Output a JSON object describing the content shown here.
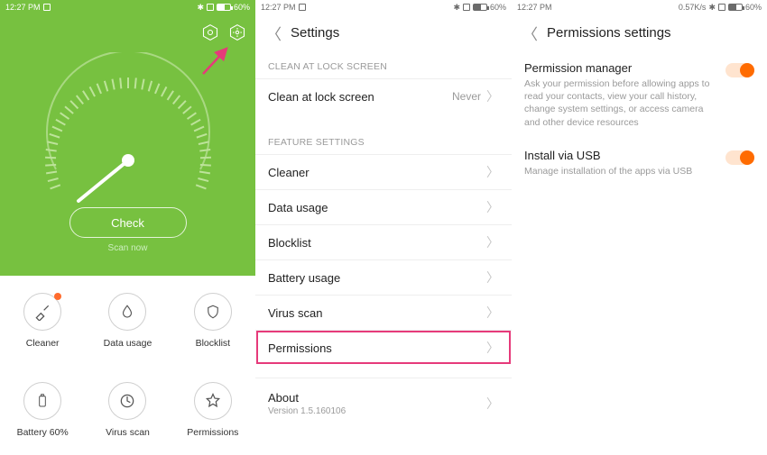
{
  "status": {
    "time": "12:27 PM",
    "battery_pct": "60%",
    "netspeed": "0.57K/s"
  },
  "panel1": {
    "top_icons": [
      "shield-outline-icon",
      "gear-icon"
    ],
    "check_label": "Check",
    "scan_now": "Scan now",
    "tiles": [
      {
        "id": "cleaner",
        "label": "Cleaner",
        "icon": "brush-icon",
        "badge": true
      },
      {
        "id": "data-usage",
        "label": "Data usage",
        "icon": "drop-icon",
        "badge": false
      },
      {
        "id": "blocklist",
        "label": "Blocklist",
        "icon": "shield-icon",
        "badge": false
      },
      {
        "id": "battery",
        "label": "Battery 60%",
        "icon": "battery-icon",
        "badge": false
      },
      {
        "id": "virus-scan",
        "label": "Virus scan",
        "icon": "scan-icon",
        "badge": false
      },
      {
        "id": "permissions",
        "label": "Permissions",
        "icon": "star-icon",
        "badge": false
      }
    ]
  },
  "panel2": {
    "title": "Settings",
    "sections": [
      {
        "title": "CLEAN AT LOCK SCREEN",
        "rows": [
          {
            "id": "clean-lock",
            "label": "Clean at lock screen",
            "value": "Never"
          }
        ]
      },
      {
        "title": "FEATURE SETTINGS",
        "rows": [
          {
            "id": "cleaner",
            "label": "Cleaner"
          },
          {
            "id": "data-usage",
            "label": "Data usage"
          },
          {
            "id": "blocklist",
            "label": "Blocklist"
          },
          {
            "id": "battery-usage",
            "label": "Battery usage"
          },
          {
            "id": "virus-scan",
            "label": "Virus scan"
          },
          {
            "id": "permissions",
            "label": "Permissions",
            "highlight": true
          }
        ]
      }
    ],
    "bottom": {
      "label": "About",
      "sub": "Version 1.5.160106"
    }
  },
  "panel3": {
    "title": "Permissions settings",
    "items": [
      {
        "id": "perm-mgr",
        "title": "Permission manager",
        "sub": "Ask your permission before allowing apps to read your contacts, view your call history, change system settings, or access camera and other device resources",
        "on": true
      },
      {
        "id": "install-usb",
        "title": "Install via USB",
        "sub": "Manage installation of the apps via USB",
        "on": true
      }
    ]
  }
}
